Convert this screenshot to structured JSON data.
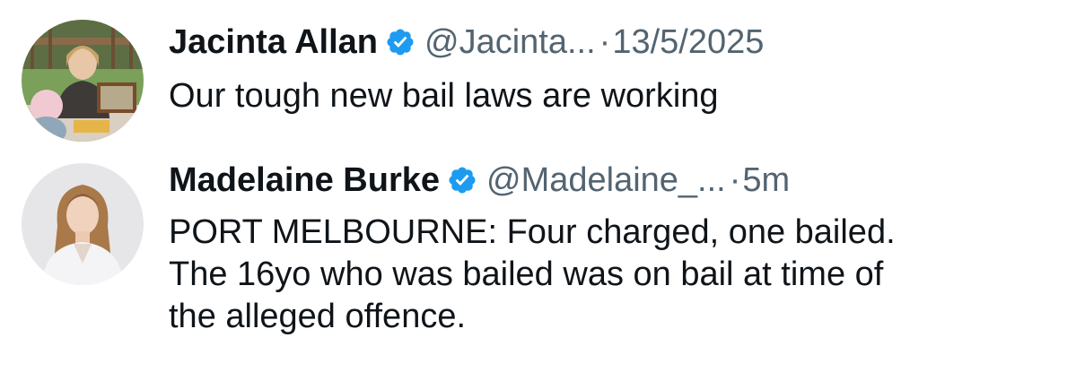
{
  "tweets": [
    {
      "author_name": "Jacinta Allan",
      "handle": "@Jacinta...",
      "separator": "·",
      "timestamp": "13/5/2025",
      "verified_icon": "verified-badge-icon",
      "body_lines": [
        "Our tough new bail laws are working"
      ]
    },
    {
      "author_name": "Madelaine Burke",
      "handle": "@Madelaine_...",
      "separator": "·",
      "timestamp": "5m",
      "verified_icon": "verified-badge-icon",
      "body_lines": [
        "PORT MELBOURNE: Four charged, one bailed.",
        "The 16yo who was bailed was on bail at time of",
        "the alleged offence."
      ]
    }
  ],
  "colors": {
    "name_text": "#0f1419",
    "secondary_text": "#536471",
    "verified_blue": "#1d9bf0",
    "background": "#ffffff"
  }
}
